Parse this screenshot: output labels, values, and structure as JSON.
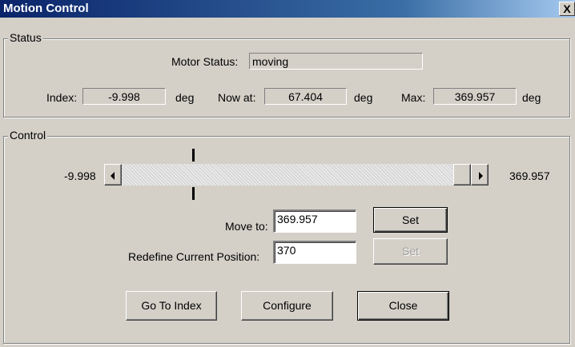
{
  "window": {
    "title": "Motion Control",
    "close_label": "X"
  },
  "status": {
    "legend": "Status",
    "motor_status_label": "Motor Status:",
    "motor_status_value": "moving",
    "index_label": "Index:",
    "index_value": "-9.998",
    "index_unit": "deg",
    "now_label": "Now at:",
    "now_value": "67.404",
    "now_unit": "deg",
    "max_label": "Max:",
    "max_value": "369.957",
    "max_unit": "deg"
  },
  "control": {
    "legend": "Control",
    "slider_min": "-9.998",
    "slider_max": "369.957",
    "slider_marker_fraction": 0.203,
    "slider_thumb_fraction": 1.0,
    "move_to_label": "Move to:",
    "move_to_value": "369.957",
    "move_set_label": "Set",
    "redefine_label": "Redefine Current Position:",
    "redefine_value": "370",
    "redefine_set_label": "Set"
  },
  "buttons": {
    "go_to_index": "Go To Index",
    "configure": "Configure",
    "close": "Close"
  }
}
